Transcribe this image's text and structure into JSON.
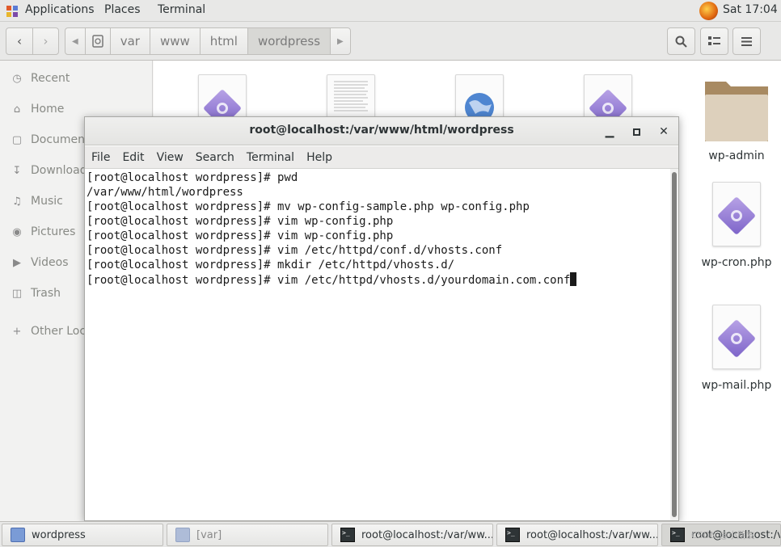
{
  "topbar": {
    "applications": "Applications",
    "places": "Places",
    "terminal": "Terminal",
    "clock": "Sat 17:04"
  },
  "pathbar": {
    "crumbs": [
      "var",
      "www",
      "html",
      "wordpress"
    ]
  },
  "sidebar": {
    "items": [
      {
        "label": "Recent",
        "icon": "clock-icon"
      },
      {
        "label": "Home",
        "icon": "home-icon"
      },
      {
        "label": "Documents",
        "icon": "document-icon"
      },
      {
        "label": "Downloads",
        "icon": "download-icon"
      },
      {
        "label": "Music",
        "icon": "music-icon"
      },
      {
        "label": "Pictures",
        "icon": "camera-icon"
      },
      {
        "label": "Videos",
        "icon": "video-icon"
      },
      {
        "label": "Trash",
        "icon": "trash-icon"
      },
      {
        "label": "Other Locations",
        "icon": "plus-icon"
      }
    ]
  },
  "files": {
    "wp_admin": "wp-admin",
    "wp_cron": "wp-cron.php",
    "wp_mail": "wp-mail.php"
  },
  "terminal": {
    "title": "root@localhost:/var/www/html/wordpress",
    "menu": [
      "File",
      "Edit",
      "View",
      "Search",
      "Terminal",
      "Help"
    ],
    "lines": [
      "[root@localhost wordpress]# pwd",
      "/var/www/html/wordpress",
      "[root@localhost wordpress]# mv wp-config-sample.php wp-config.php",
      "[root@localhost wordpress]# vim wp-config.php",
      "[root@localhost wordpress]# vim wp-config.php",
      "[root@localhost wordpress]# vim /etc/httpd/conf.d/vhosts.conf",
      "[root@localhost wordpress]# mkdir /etc/httpd/vhosts.d/",
      "[root@localhost wordpress]# vim /etc/httpd/vhosts.d/yourdomain.com.conf"
    ]
  },
  "taskbar": {
    "tasks": [
      {
        "label": "wordpress"
      },
      {
        "label": "[var]"
      },
      {
        "label": "root@localhost:/var/ww..."
      },
      {
        "label": "root@localhost:/var/ww..."
      },
      {
        "label": "root@localhost:/var/"
      }
    ],
    "watermark": "CSDN @小朋友"
  }
}
